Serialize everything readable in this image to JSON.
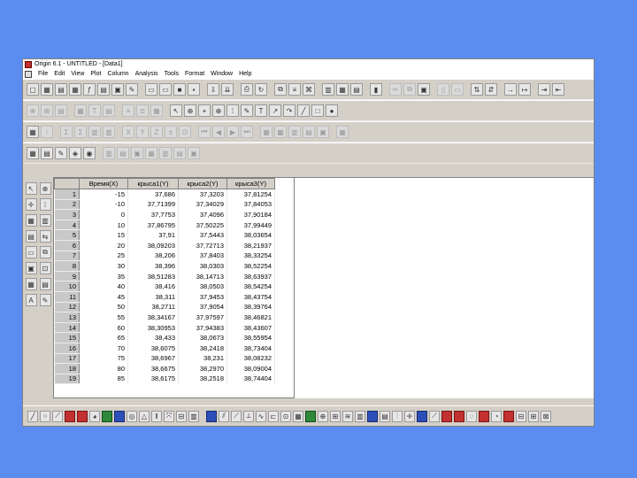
{
  "window": {
    "title": "Origin 6.1 - UNTITLED - [Data1]"
  },
  "menu": [
    "File",
    "Edit",
    "View",
    "Plot",
    "Column",
    "Analysis",
    "Tools",
    "Format",
    "Window",
    "Help"
  ],
  "worksheet": {
    "columns": [
      "Время(X)",
      "крыса1(Y)",
      "крыса2(Y)",
      "крыса3(Y)"
    ],
    "rows": [
      {
        "n": "1",
        "v": [
          "-15",
          "37,686",
          "37,3203",
          "37,81254"
        ]
      },
      {
        "n": "2",
        "v": [
          "-10",
          "37,71399",
          "37,34029",
          "37,84053"
        ]
      },
      {
        "n": "3",
        "v": [
          "0",
          "37,7753",
          "37,4096",
          "37,90184"
        ]
      },
      {
        "n": "4",
        "v": [
          "10",
          "37,86795",
          "37,50225",
          "37,99449"
        ]
      },
      {
        "n": "5",
        "v": [
          "15",
          "37,91",
          "37,5443",
          "38,03654"
        ]
      },
      {
        "n": "6",
        "v": [
          "20",
          "38,09203",
          "37,72713",
          "38,21937"
        ]
      },
      {
        "n": "7",
        "v": [
          "25",
          "38,206",
          "37,8403",
          "38,33254"
        ]
      },
      {
        "n": "8",
        "v": [
          "30",
          "38,396",
          "38,0303",
          "38,52254"
        ]
      },
      {
        "n": "9",
        "v": [
          "35",
          "38,51283",
          "38,14713",
          "38,63937"
        ]
      },
      {
        "n": "10",
        "v": [
          "40",
          "38,416",
          "38,0503",
          "38,54254"
        ]
      },
      {
        "n": "11",
        "v": [
          "45",
          "38,311",
          "37,9453",
          "38,43754"
        ]
      },
      {
        "n": "12",
        "v": [
          "50",
          "38,2711",
          "37,9054",
          "38,39764"
        ]
      },
      {
        "n": "13",
        "v": [
          "55",
          "38,34167",
          "37,97597",
          "38,46821"
        ]
      },
      {
        "n": "14",
        "v": [
          "60",
          "38,30953",
          "37,94383",
          "38,43607"
        ]
      },
      {
        "n": "15",
        "v": [
          "65",
          "38,433",
          "38,0673",
          "38,55954"
        ]
      },
      {
        "n": "16",
        "v": [
          "70",
          "38,6075",
          "38,2418",
          "38,73404"
        ]
      },
      {
        "n": "17",
        "v": [
          "75",
          "38,6967",
          "38,231",
          "38,08232"
        ]
      },
      {
        "n": "18",
        "v": [
          "80",
          "38,6675",
          "38,2970",
          "38,09004"
        ]
      },
      {
        "n": "19",
        "v": [
          "85",
          "38,6175",
          "38,2518",
          "38,74404"
        ]
      }
    ]
  },
  "colors": {
    "desktop": "#5b8cf0",
    "chrome": "#d4d0c8"
  }
}
